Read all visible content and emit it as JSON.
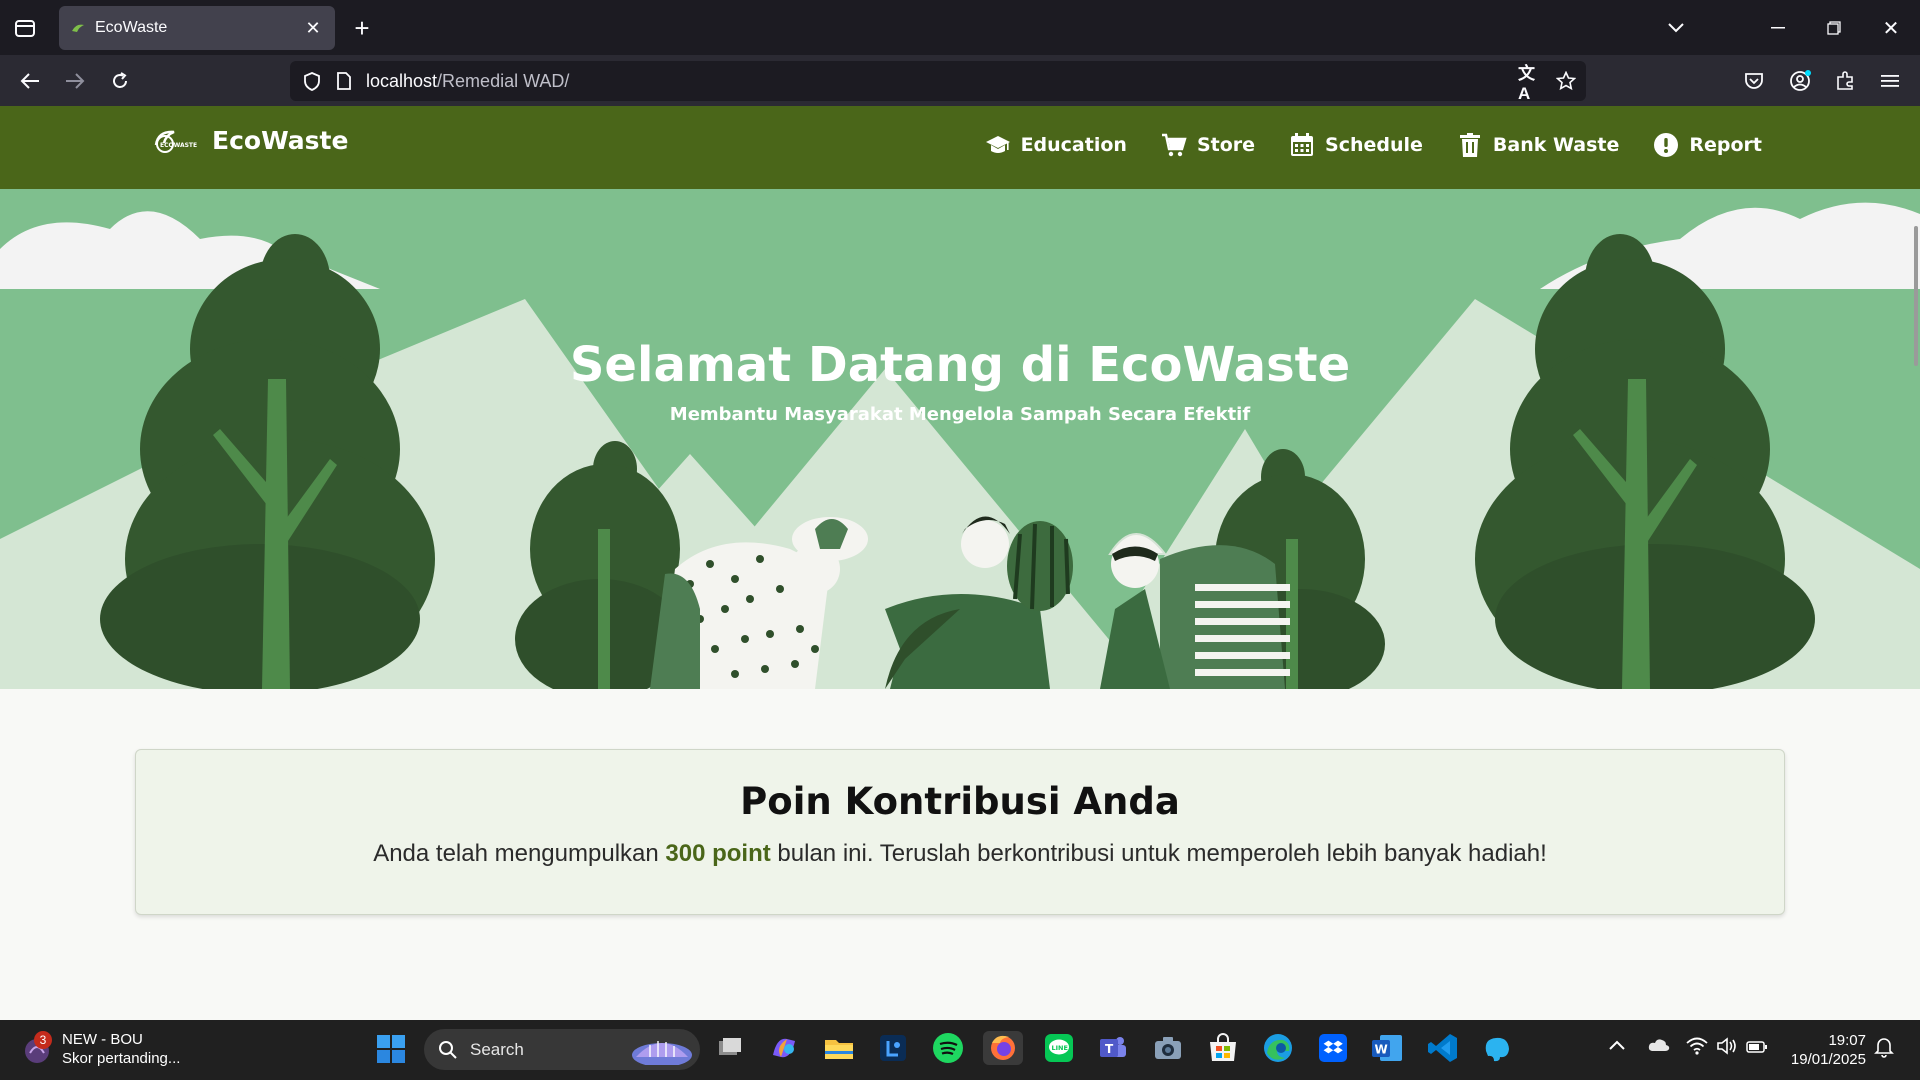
{
  "browser": {
    "tab_title": "EcoWaste",
    "url_host": "localhost",
    "url_path": "/Remedial WAD/"
  },
  "site": {
    "brand": "EcoWaste",
    "nav": [
      {
        "label": "Education",
        "icon": "graduation-cap-icon"
      },
      {
        "label": "Store",
        "icon": "cart-icon"
      },
      {
        "label": "Schedule",
        "icon": "calendar-icon"
      },
      {
        "label": "Bank Waste",
        "icon": "trash-icon"
      },
      {
        "label": "Report",
        "icon": "alert-icon"
      }
    ],
    "accent_color": "#4a6619"
  },
  "hero": {
    "title": "Selamat Datang di EcoWaste",
    "subtitle": "Membantu Masyarakat Mengelola Sampah Secara Efektif"
  },
  "points": {
    "title": "Poin Kontribusi Anda",
    "text_before": "Anda telah mengumpulkan",
    "value": "300 point",
    "text_after": "bulan ini. Teruslah berkontribusi untuk memperoleh lebih banyak hadiah!"
  },
  "taskbar": {
    "widget_badge": "3",
    "widget_title": "NEW - BOU",
    "widget_subtitle": "Skor pertanding...",
    "search_label": "Search",
    "time": "19:07",
    "date": "19/01/2025"
  }
}
